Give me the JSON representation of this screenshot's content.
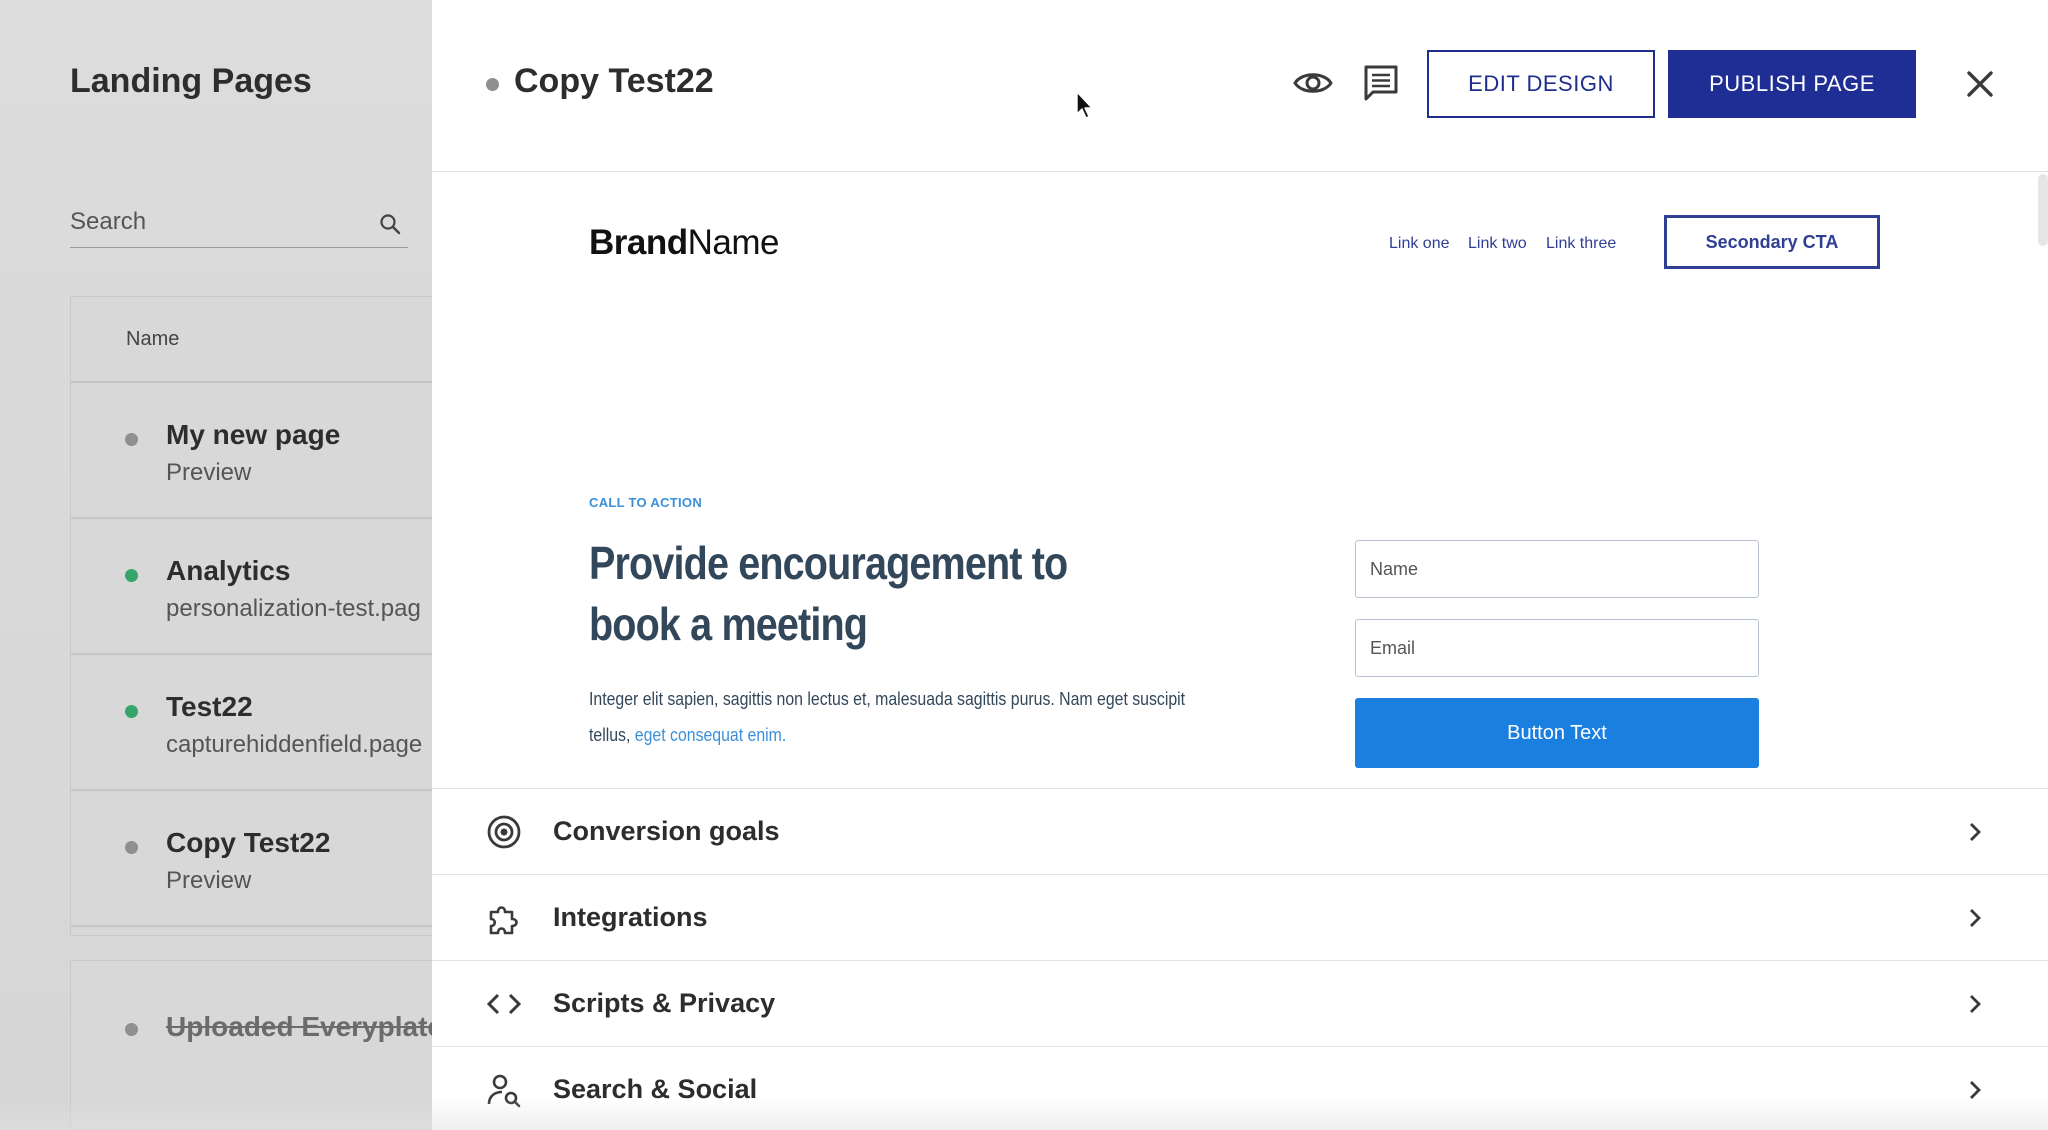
{
  "background": {
    "title": "Landing Pages",
    "search_placeholder": "Search",
    "table_header": "Name",
    "rows": [
      {
        "name": "My new page",
        "sub": "Preview",
        "status": "draft"
      },
      {
        "name": "Analytics",
        "sub": "personalization-test.pag",
        "status": "published"
      },
      {
        "name": "Test22",
        "sub": "capturehiddenfield.page",
        "status": "published"
      },
      {
        "name": "Copy Test22",
        "sub": "Preview",
        "status": "draft"
      }
    ],
    "archived_row": {
      "name": "Uploaded Everyplate",
      "status": "archived"
    }
  },
  "panel": {
    "title": "Copy Test22",
    "status": "draft",
    "actions": {
      "preview_icon": "eye-icon",
      "comments_icon": "comment-icon",
      "edit_label": "EDIT DESIGN",
      "publish_label": "PUBLISH PAGE",
      "close_icon": "close-icon"
    }
  },
  "preview": {
    "brand_bold": "Brand",
    "brand_regular": "Name",
    "nav_links": [
      "Link one",
      "Link two",
      "Link three"
    ],
    "secondary_cta": "Secondary CTA",
    "eyebrow": "CALL TO ACTION",
    "headline": "Provide encouragement to book a meeting",
    "body": "Integer elit sapien, sagittis non lectus et, malesuada sagittis purus. Nam eget suscipit tellus,",
    "body_link": "eget consequat enim.",
    "form": {
      "name_placeholder": "Name",
      "email_placeholder": "Email",
      "button_label": "Button Text"
    }
  },
  "settings": [
    {
      "label": "Conversion goals",
      "icon": "target-icon"
    },
    {
      "label": "Integrations",
      "icon": "puzzle-icon"
    },
    {
      "label": "Scripts & Privacy",
      "icon": "code-icon"
    },
    {
      "label": "Search & Social",
      "icon": "person-search-icon"
    }
  ],
  "colors": {
    "primary_dark": "#1f2e94",
    "accent_blue": "#1b7fe0",
    "published_green": "#36a56a",
    "draft_gray": "#8f8f8f"
  }
}
